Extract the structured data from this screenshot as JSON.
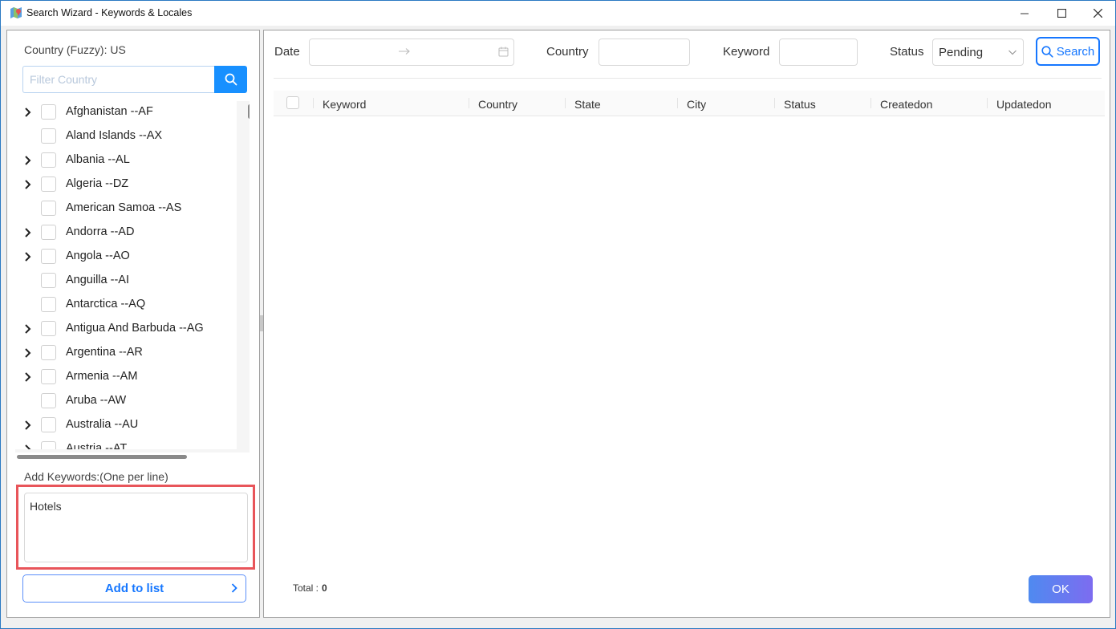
{
  "window": {
    "title": "Search Wizard - Keywords & Locales"
  },
  "left": {
    "country_label": "Country (Fuzzy): US",
    "filter_placeholder": "Filter Country",
    "countries": [
      {
        "label": "Afghanistan --AF",
        "expandable": true
      },
      {
        "label": "Aland Islands --AX",
        "expandable": false
      },
      {
        "label": "Albania --AL",
        "expandable": true
      },
      {
        "label": "Algeria --DZ",
        "expandable": true
      },
      {
        "label": "American Samoa --AS",
        "expandable": false
      },
      {
        "label": "Andorra --AD",
        "expandable": true
      },
      {
        "label": "Angola --AO",
        "expandable": true
      },
      {
        "label": "Anguilla --AI",
        "expandable": false
      },
      {
        "label": "Antarctica --AQ",
        "expandable": false
      },
      {
        "label": "Antigua And Barbuda --AG",
        "expandable": true
      },
      {
        "label": "Argentina --AR",
        "expandable": true
      },
      {
        "label": "Armenia --AM",
        "expandable": true
      },
      {
        "label": "Aruba --AW",
        "expandable": false
      },
      {
        "label": "Australia --AU",
        "expandable": true
      },
      {
        "label": "Austria --AT",
        "expandable": true
      }
    ],
    "keywords_label": "Add Keywords:(One per line)",
    "keywords_value": "Hotels",
    "add_button": "Add to list"
  },
  "filters": {
    "date_label": "Date",
    "country_label": "Country",
    "keyword_label": "Keyword",
    "status_label": "Status",
    "status_value": "Pending",
    "search_button": "Search"
  },
  "table": {
    "columns": [
      "Keyword",
      "Country",
      "State",
      "City",
      "Status",
      "Createdon",
      "Updatedon"
    ],
    "rows": []
  },
  "footer": {
    "total_label": "Total :",
    "total_value": "0",
    "ok_button": "OK"
  },
  "colors": {
    "accent": "#1677ff",
    "highlight": "#e8555a",
    "ok_gradient_start": "#4f8af0",
    "ok_gradient_end": "#7d6cf0"
  }
}
